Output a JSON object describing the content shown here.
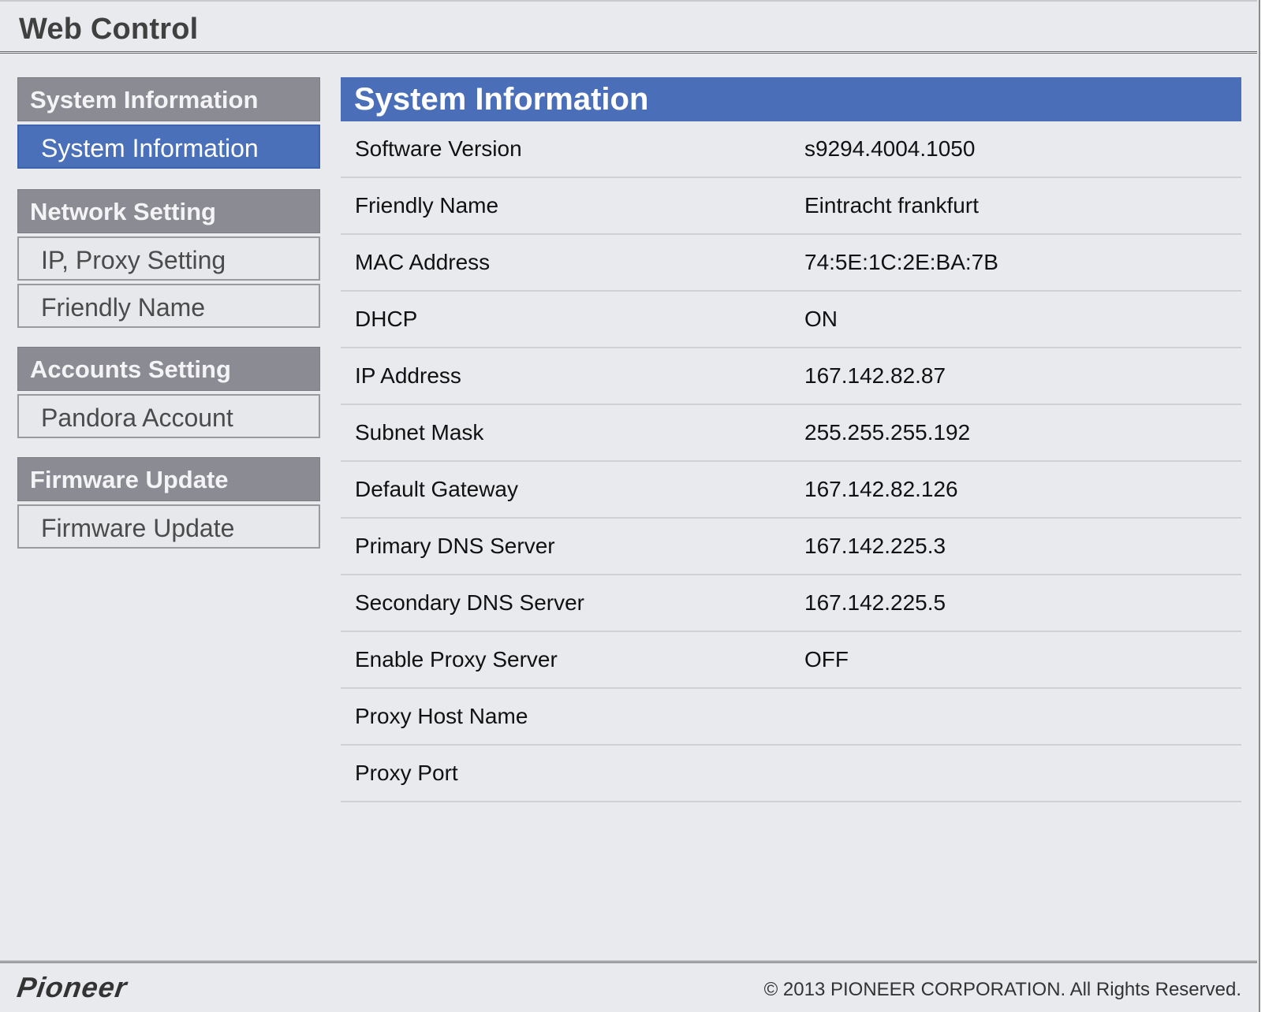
{
  "header": {
    "title": "Web Control"
  },
  "sidebar": {
    "groups": [
      {
        "heading": "System Information",
        "items": [
          {
            "label": "System Information",
            "active": true
          }
        ]
      },
      {
        "heading": "Network Setting",
        "items": [
          {
            "label": "IP, Proxy Setting"
          },
          {
            "label": "Friendly Name"
          }
        ]
      },
      {
        "heading": "Accounts Setting",
        "items": [
          {
            "label": "Pandora Account"
          }
        ]
      },
      {
        "heading": "Firmware Update",
        "items": [
          {
            "label": "Firmware Update"
          }
        ]
      }
    ]
  },
  "main": {
    "title": "System Information",
    "rows": [
      {
        "label": "Software Version",
        "value": "s9294.4004.1050"
      },
      {
        "label": "Friendly Name",
        "value": "Eintracht frankfurt"
      },
      {
        "label": "MAC Address",
        "value": "74:5E:1C:2E:BA:7B"
      },
      {
        "label": "DHCP",
        "value": "ON"
      },
      {
        "label": "IP Address",
        "value": "167.142.82.87"
      },
      {
        "label": "Subnet Mask",
        "value": "255.255.255.192"
      },
      {
        "label": "Default Gateway",
        "value": "167.142.82.126"
      },
      {
        "label": "Primary DNS Server",
        "value": "167.142.225.3"
      },
      {
        "label": "Secondary DNS Server",
        "value": "167.142.225.5"
      },
      {
        "label": "Enable Proxy Server",
        "value": "OFF"
      },
      {
        "label": "Proxy Host Name",
        "value": ""
      },
      {
        "label": "Proxy Port",
        "value": ""
      }
    ]
  },
  "footer": {
    "logo": "Pioneer",
    "copyright": "© 2013 PIONEER CORPORATION. All Rights Reserved."
  },
  "colors": {
    "accent": "#4a6fb8",
    "nav_heading": "#8b8b94",
    "background": "#e9eaee"
  }
}
